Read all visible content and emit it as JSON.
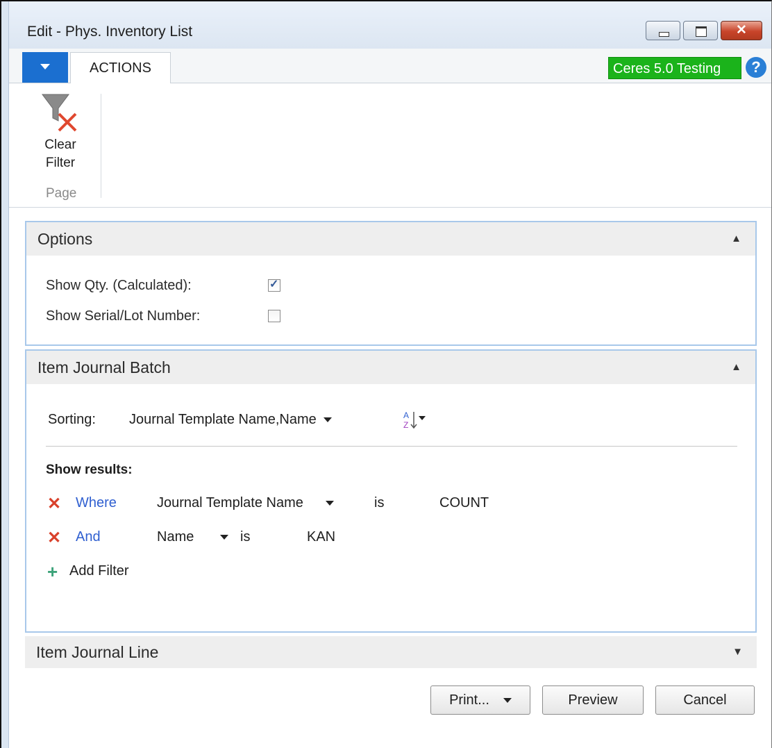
{
  "window": {
    "title": "Edit - Phys. Inventory List"
  },
  "tabs": {
    "actions_label": "ACTIONS"
  },
  "environment_badge": "Ceres 5.0 Testing",
  "help_glyph": "?",
  "ribbon": {
    "clear_filter_label_1": "Clear",
    "clear_filter_label_2": "Filter",
    "group_label": "Page"
  },
  "options": {
    "header": "Options",
    "show_qty_label": "Show Qty. (Calculated):",
    "show_qty_checked": true,
    "show_serial_label": "Show Serial/Lot Number:",
    "show_serial_checked": false
  },
  "item_journal_batch": {
    "header": "Item Journal Batch",
    "sorting_label": "Sorting:",
    "sorting_value": "Journal Template Name,Name",
    "show_results_label": "Show results:",
    "filters": [
      {
        "connector": "Where",
        "field": "Journal Template Name",
        "operator": "is",
        "value": "COUNT"
      },
      {
        "connector": "And",
        "field": "Name",
        "operator": "is",
        "value": "KAN"
      }
    ],
    "add_filter_label": "Add Filter"
  },
  "item_journal_line": {
    "header": "Item Journal Line"
  },
  "buttons": {
    "print": "Print...",
    "preview": "Preview",
    "cancel": "Cancel"
  },
  "colors": {
    "accent": "#1b6fd0",
    "badge": "#1bb31b",
    "link": "#2f5fd0",
    "remove": "#d9412b",
    "add": "#3da37a"
  },
  "icons": [
    "menu-caret-icon",
    "help-icon",
    "clear-filter-icon",
    "sort-az-icon",
    "remove-filter-icon",
    "add-filter-icon",
    "chevron-up-icon",
    "chevron-down-icon"
  ]
}
